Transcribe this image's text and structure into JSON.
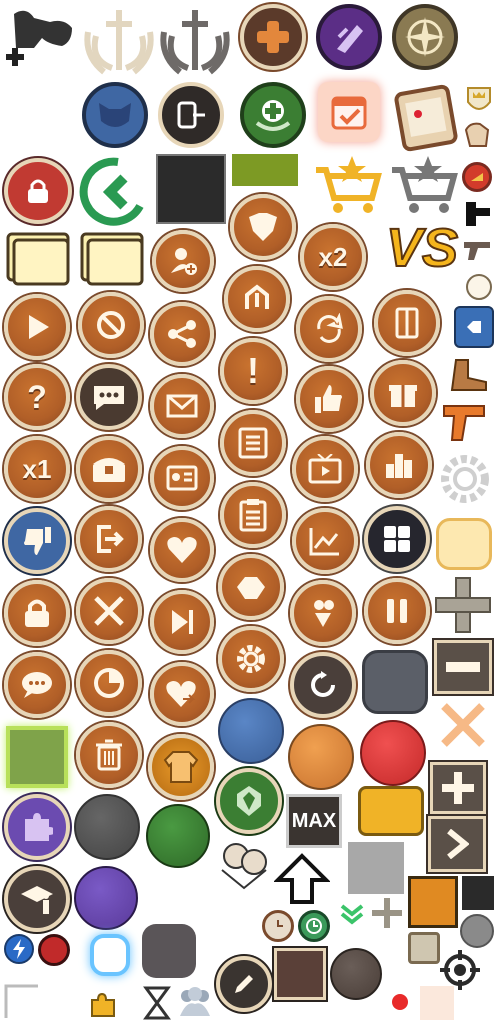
{
  "labels": {
    "x2": "x2",
    "x1": "x1",
    "vs": "VS",
    "max": "MAX"
  },
  "colors": {
    "brown": "#b15f28",
    "rim": "#e7d6b8",
    "blue": "#3f67a3",
    "red": "#d63b3b",
    "green": "#3b7e33",
    "purple": "#6b4bb0",
    "olive": "#7d9a24",
    "gold": "#f0b327",
    "grey": "#5b5f68"
  },
  "icons": [
    "puzzle-plus-icon",
    "sword-wings-light-icon",
    "sword-wings-dark-icon",
    "hammer-badge-icon",
    "claw-badge-icon",
    "compass-badge-icon",
    "mask-badge-icon",
    "exit-door-badge-icon",
    "heal-plus-badge-icon",
    "calendar-check-icon",
    "calendar-book-icon",
    "shield-crown-icon",
    "lock-badge-icon",
    "back-arrow-icon",
    "dark-square-icon",
    "olive-bar-icon",
    "cart-star-gold-icon",
    "cart-star-grey-icon",
    "fist-icon",
    "cheese-badge-icon",
    "cards-icon",
    "pistol-icon",
    "ticket-stack-icon",
    "add-user-icon",
    "armor-icon",
    "x2-icon",
    "vs-icon",
    "play-icon",
    "forbidden-icon",
    "share-icon",
    "rank-up-icon",
    "refresh-icon",
    "book-icon",
    "white-dot-icon",
    "key-tag-icon",
    "help-icon",
    "chat-icon",
    "mail-icon",
    "alert-icon",
    "thumbs-up-icon",
    "gift-icon",
    "boot-icon",
    "gun-orange-icon",
    "x1-icon",
    "chest-icon",
    "id-card-icon",
    "list-icon",
    "tv-icon",
    "leaderboard-icon",
    "gear-outline-icon",
    "thumbs-down-icon",
    "logout-icon",
    "heart-icon",
    "clipboard-icon",
    "chart-icon",
    "grid-icon",
    "cream-square-icon",
    "lock-icon",
    "crossed-swords-icon",
    "skip-icon",
    "squad-icon",
    "transfer-icon",
    "pause-icon",
    "plus-grey-icon",
    "speech-icon",
    "pie-icon",
    "heart-share-icon",
    "gear-icon",
    "restart-icon",
    "grey-square-icon",
    "minus-icon",
    "green-square-icon",
    "trash-icon",
    "jacket-icon",
    "blue-circle-icon",
    "orange-circle-icon",
    "red-circle-icon",
    "swords-glow-icon",
    "puzzle-purple-icon",
    "grey-circle-icon",
    "green-circle-icon",
    "emblem-icon",
    "max-icon",
    "ticket-gold-icon",
    "plus-box-icon",
    "info-hat-icon",
    "purple-circle-icon",
    "heads-icon",
    "up-arrow-icon",
    "light-grey-square-icon",
    "orange-square-icon",
    "next-box-icon",
    "clock-icon",
    "timer-icon",
    "chevron-green-icon",
    "plus-small-icon",
    "beige-square-icon",
    "black-square-icon",
    "energy-icon",
    "red-dot-icon",
    "glow-square-icon",
    "dark-square-round-icon",
    "edit-icon",
    "brown-square-icon",
    "rock-circle-icon",
    "target-icon",
    "corner-icon",
    "puzzle-small-icon",
    "hourglass-icon",
    "group-icon",
    "small-red-dot-icon",
    "peach-square-icon"
  ]
}
